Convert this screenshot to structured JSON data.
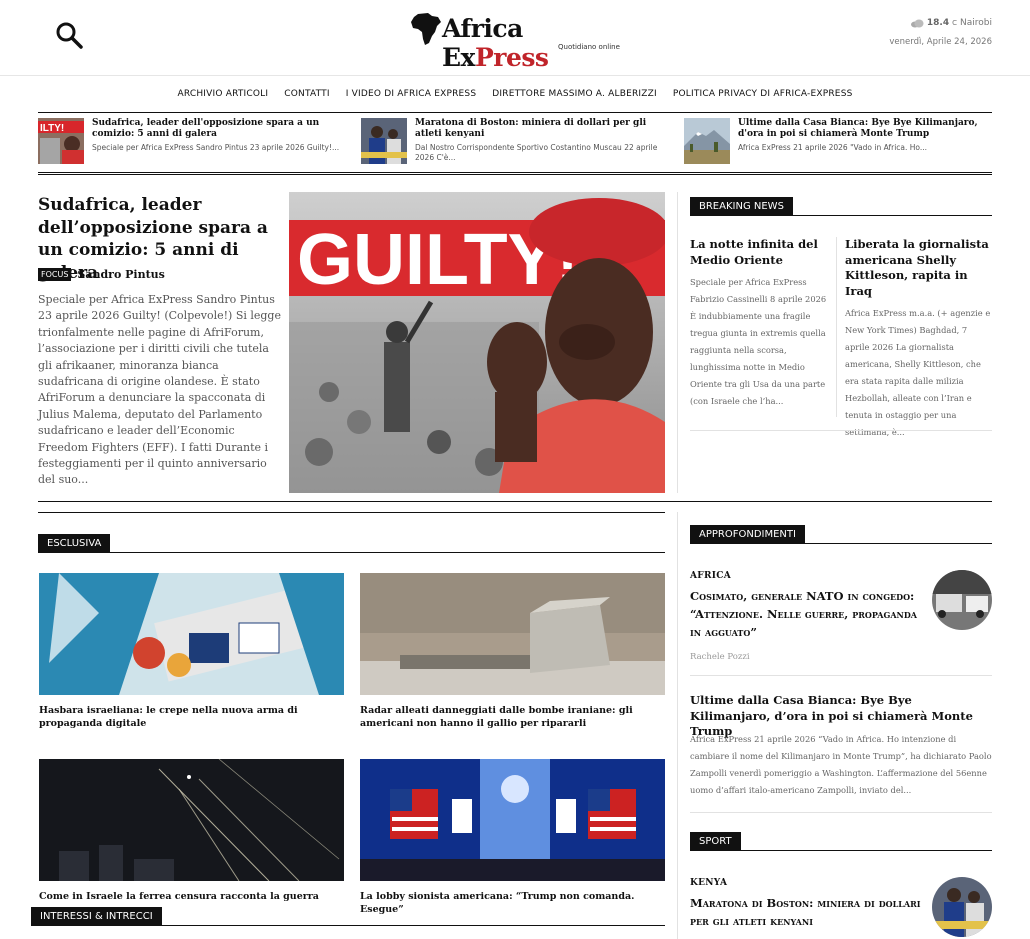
{
  "header": {
    "logo_word_a": "Africa Ex",
    "logo_word_b": "Press",
    "logo_tagline": "Quotidiano online",
    "weather": {
      "temp": "18.4",
      "unit": "C",
      "city": "Nairobi",
      "date": "venerdì, Aprile 24, 2026"
    }
  },
  "nav": [
    "ARCHIVIO ARTICOLI",
    "CONTATTI",
    "I VIDEO DI AFRICA EXPRESS",
    "DIRETTORE MASSIMO A. ALBERIZZI",
    "POLITICA PRIVACY DI AFRICA-EXPRESS"
  ],
  "ticker": [
    {
      "title": "Sudafrica, leader dell'opposizione spara a un comizio: 5 anni di galera",
      "excerpt": "Speciale per Africa ExPress Sandro Pintus 23 aprile 2026 Guilty!..."
    },
    {
      "title": "Maratona di Boston: miniera di dollari per gli atleti kenyani",
      "excerpt": "Dal Nostro Corrispondente Sportivo Costantino Muscau 22 aprile 2026 C'è..."
    },
    {
      "title": "Ultime dalla Casa Bianca: Bye Bye Kilimanjaro, d'ora in poi si chiamerà Monte Trump",
      "excerpt": "Africa ExPress 21 aprile 2026 \"Vado in Africa. Ho..."
    }
  ],
  "featured": {
    "title": "Sudafrica, leader dell’opposizione spara a un comizio: 5 anni di galera",
    "category": "FOCUS",
    "author": "Sandro Pintus",
    "excerpt": "Speciale per Africa ExPress Sandro Pintus 23 aprile 2026 Guilty! (Colpevole!) Si legge trionfalmente nelle pagine di AfriForum, l’associazione per i diritti civili che tutela gli afrikaaner, minoranza bianca sudafricana di origine olandese. È stato AfriForum a denunciare la spacconata di Julius Malema, deputato del Parlamento sudafricano e leader dell’Economic Freedom Fighters (EFF). I fatti Durante i festeggiamenti per il quinto anniversario del suo...",
    "image_text": "GUILTY!"
  },
  "breaking": {
    "label": "BREAKING NEWS",
    "items": [
      {
        "title": "La notte infinita del Medio Oriente",
        "excerpt": "Speciale per Africa ExPress Fabrizio Cassinelli 8 aprile 2026 È indubbiamente una fragile tregua giunta in extremis quella raggiunta nella scorsa, lunghissima notte in Medio Oriente tra gli Usa da una parte (con Israele che l’ha..."
      },
      {
        "title": "Liberata la giornalista americana Shelly Kittleson, rapita in Iraq",
        "excerpt": "Africa ExPress m.a.a. (+ agenzie e New York Times) Baghdad, 7 aprile 2026 La giornalista americana, Shelly Kittleson, che era stata rapita dalle milizia Hezbollah, alleate con l’Iran e tenuta in ostaggio per una settimana, è..."
      }
    ]
  },
  "esclusiva": {
    "label": "ESCLUSIVA",
    "cards": [
      {
        "caption": "Hasbara israeliana: le crepe nella nuova arma di propaganda digitale"
      },
      {
        "caption": "Radar alleati danneggiati dalle bombe iraniane: gli americani non hanno il gallio per ripararli"
      },
      {
        "caption": "Come in Israele la ferrea censura racconta la guerra"
      },
      {
        "caption": "La lobby sionista americana: “Trump non comanda. Esegue”"
      }
    ]
  },
  "interessi": {
    "label": "INTERESSI & INTRECCI"
  },
  "approfondimenti": {
    "label": "APPROFONDIMENTI",
    "main": {
      "category": "AFRICA",
      "title": "Cosimato, generale NATO in congedo: “Attenzione. Nelle guerre, propaganda in agguato”",
      "author": "Rachele Pozzi"
    },
    "second": {
      "title": "Ultime dalla Casa Bianca: Bye Bye Kilimanjaro, d’ora in poi si chiamerà Monte Trump",
      "excerpt": "Africa ExPress 21 aprile 2026 “Vado in Africa. Ho intenzione di cambiare il nome del Kilimanjaro in Monte Trump”, ha dichiarato Paolo Zampolli venerdì pomeriggio a Washington. L’affermazione del 56enne uomo d’affari italo-americano Zampolli, inviato del..."
    }
  },
  "sport": {
    "label": "SPORT",
    "main": {
      "category": "KENYA",
      "title": "Maratona di Boston: miniera di dollari per gli atleti kenyani"
    }
  },
  "colors": {
    "accent_red": "#c0242a",
    "label_bg": "#111111"
  }
}
